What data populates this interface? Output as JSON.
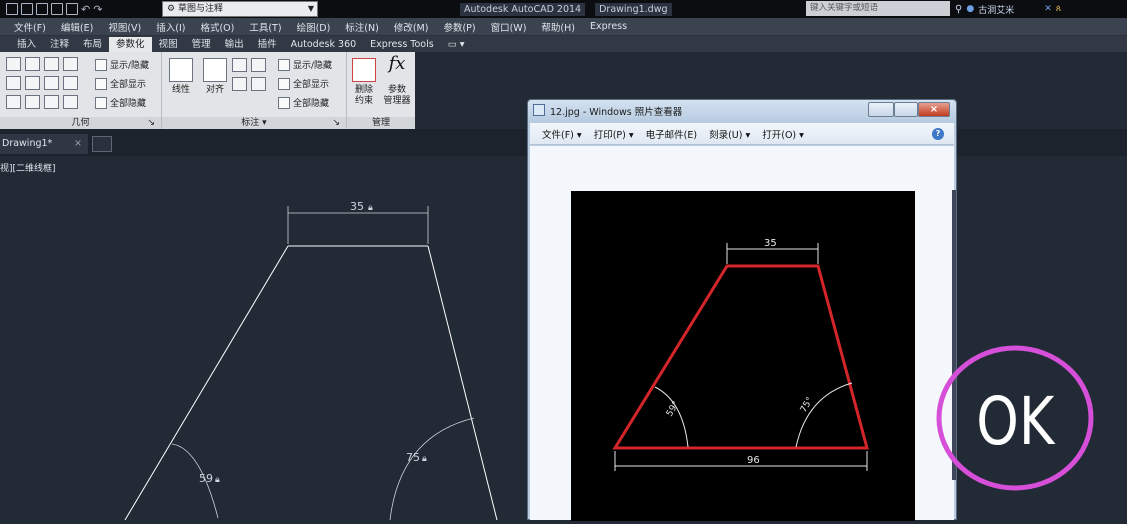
{
  "titlebar": {
    "workspace": "草图与注释",
    "app_title": "Autodesk AutoCAD 2014",
    "file_name": "Drawing1.dwg",
    "search_placeholder": "键入关键字或短语",
    "user": "古洞艾米"
  },
  "menubar": [
    "文件(F)",
    "编辑(E)",
    "视图(V)",
    "插入(I)",
    "格式(O)",
    "工具(T)",
    "绘图(D)",
    "标注(N)",
    "修改(M)",
    "参数(P)",
    "窗口(W)",
    "帮助(H)",
    "Express"
  ],
  "ribbon_tabs": [
    "插入",
    "注释",
    "布局",
    "参数化",
    "视图",
    "管理",
    "输出",
    "插件",
    "Autodesk 360",
    "Express Tools"
  ],
  "ribbon_active_tab": "参数化",
  "ribbon": {
    "geometry_panel": "几何",
    "show_hide": "显示/隐藏",
    "show_all": "全部显示",
    "hide_all": "全部隐藏",
    "linear": "线性",
    "aligned": "对齐",
    "dim_panel": "标注",
    "dim_show_hide": "显示/隐藏",
    "dim_show_all": "全部显示",
    "dim_hide_all": "全部隐藏",
    "delete_constraints_1": "删除",
    "delete_constraints_2": "约束",
    "param_manager_1": "参数",
    "param_manager_2": "管理器",
    "fx": "fx",
    "manage_panel": "管理"
  },
  "document_tab": "Drawing1*",
  "viewport_label": "视][二维线框]",
  "drawing": {
    "top_dim": "35",
    "left_angle": "59",
    "right_angle": "75"
  },
  "viewer": {
    "title": "12.jpg - Windows 照片查看器",
    "menu": [
      "文件(F)",
      "打印(P)",
      "电子邮件(E)",
      "刻录(U)",
      "打开(O)"
    ],
    "help": "?",
    "image": {
      "top_dim": "35",
      "left_angle": "59°",
      "right_angle": "75°",
      "bottom_dim": "96"
    }
  },
  "overlay_text": "OK",
  "colors": {
    "canvas": "#222a36",
    "trapezoid_red": "#d4262a",
    "circle_magenta": "#d64fd8"
  }
}
